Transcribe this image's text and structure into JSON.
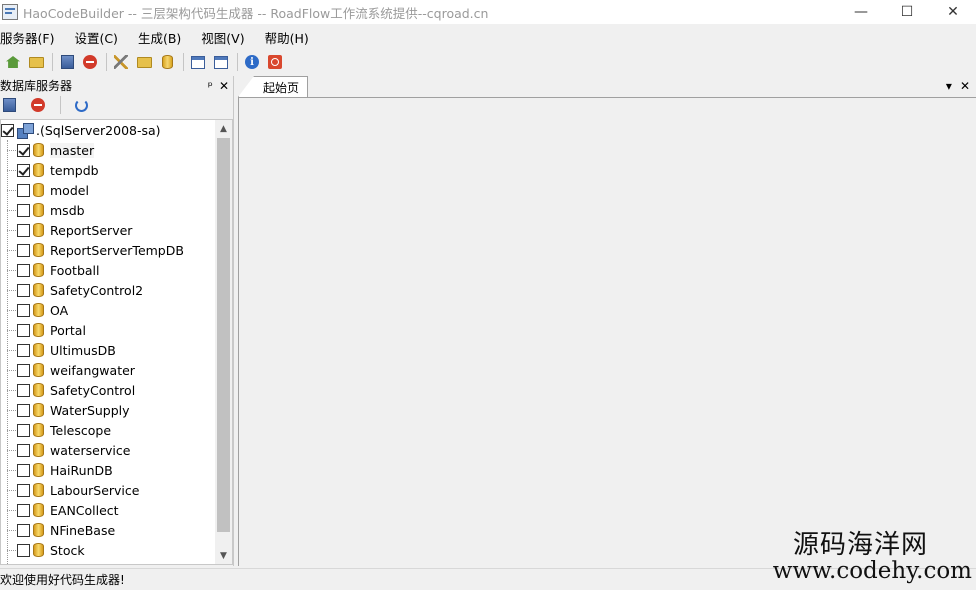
{
  "window": {
    "title": "HaoCodeBuilder -- 三层架构代码生成器 -- RoadFlow工作流系统提供--cqroad.cn",
    "minimize": "—",
    "maximize": "☐",
    "close": "✕"
  },
  "menu": {
    "items": [
      "服务器(F)",
      "设置(C)",
      "生成(B)",
      "视图(V)",
      "帮助(H)"
    ]
  },
  "toolbar": {
    "icons": [
      "home-icon",
      "server-add-icon",
      "server-connect-icon",
      "stop-icon",
      "tools-icon",
      "folder-icon",
      "database-icon",
      "window-icon",
      "window-switch-icon",
      "info-icon",
      "power-icon"
    ]
  },
  "left_panel": {
    "title": "数据库服务器",
    "pin": "ᵖ",
    "close": "✕",
    "root": ".(SqlServer2008-sa)",
    "databases": [
      {
        "name": "master",
        "checked": true
      },
      {
        "name": "tempdb",
        "checked": true
      },
      {
        "name": "model",
        "checked": false
      },
      {
        "name": "msdb",
        "checked": false
      },
      {
        "name": "ReportServer",
        "checked": false
      },
      {
        "name": "ReportServerTempDB",
        "checked": false
      },
      {
        "name": "Football",
        "checked": false
      },
      {
        "name": "SafetyControl2",
        "checked": false
      },
      {
        "name": "OA",
        "checked": false
      },
      {
        "name": "Portal",
        "checked": false
      },
      {
        "name": "UltimusDB",
        "checked": false
      },
      {
        "name": "weifangwater",
        "checked": false
      },
      {
        "name": "SafetyControl",
        "checked": false
      },
      {
        "name": "WaterSupply",
        "checked": false
      },
      {
        "name": "Telescope",
        "checked": false
      },
      {
        "name": "waterservice",
        "checked": false
      },
      {
        "name": "HaiRunDB",
        "checked": false
      },
      {
        "name": "LabourService",
        "checked": false
      },
      {
        "name": "EANCollect",
        "checked": false
      },
      {
        "name": "NFineBase",
        "checked": false
      },
      {
        "name": "Stock",
        "checked": false
      }
    ],
    "scroll_up": "▲",
    "scroll_down": "▼"
  },
  "document": {
    "tab_label": "起始页",
    "dropdown": "▾",
    "close": "✕"
  },
  "status": {
    "text": "欢迎使用好代码生成器!"
  },
  "watermark": {
    "cn": "源码海洋网",
    "url": "www.codehy.com"
  }
}
